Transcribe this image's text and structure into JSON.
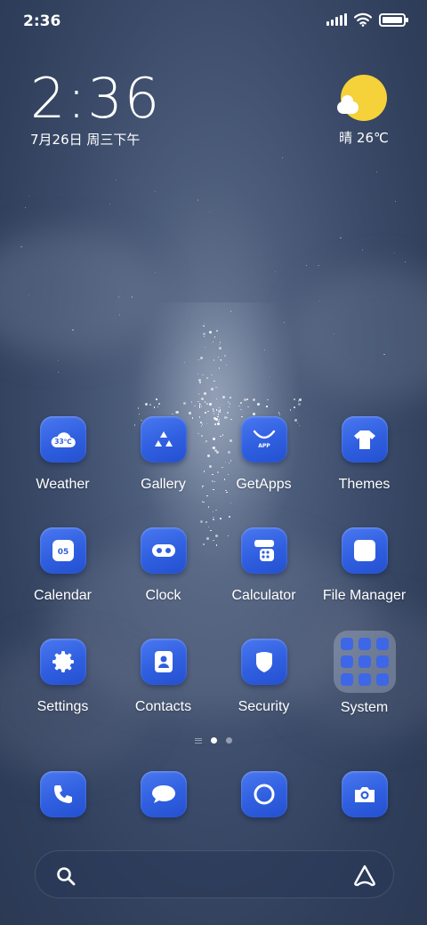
{
  "status_bar": {
    "time": "2:36",
    "icons": [
      "signal-icon",
      "wifi-icon",
      "battery-icon"
    ],
    "battery_level": 1.0
  },
  "clock_widget": {
    "time": "2:36",
    "date": "7月26日 周三下午"
  },
  "weather_widget": {
    "icon": "sun-cloud-icon",
    "text": "晴 26℃"
  },
  "apps": [
    {
      "label": "Weather",
      "icon": "weather-icon",
      "badge": "33℃"
    },
    {
      "label": "Gallery",
      "icon": "gallery-icon"
    },
    {
      "label": "GetApps",
      "icon": "getapps-icon",
      "badge": "APP"
    },
    {
      "label": "Themes",
      "icon": "themes-icon"
    },
    {
      "label": "Calendar",
      "icon": "calendar-icon",
      "badge": "05"
    },
    {
      "label": "Clock",
      "icon": "clock-icon"
    },
    {
      "label": "Calculator",
      "icon": "calculator-icon"
    },
    {
      "label": "File Manager",
      "icon": "file-manager-icon"
    },
    {
      "label": "Settings",
      "icon": "settings-icon"
    },
    {
      "label": "Contacts",
      "icon": "contacts-icon"
    },
    {
      "label": "Security",
      "icon": "security-icon"
    },
    {
      "label": "System",
      "icon": "folder-icon"
    }
  ],
  "pager": {
    "pages": 2,
    "active_page": 1
  },
  "dock": [
    {
      "icon": "phone-icon"
    },
    {
      "icon": "messages-icon"
    },
    {
      "icon": "browser-icon"
    },
    {
      "icon": "camera-icon"
    }
  ],
  "search_bar": {
    "left_icon": "search-icon",
    "right_icon": "assistant-icon"
  },
  "colors": {
    "icon_blue": "#3563e6",
    "sun": "#f5d13a",
    "wallpaper": "#3a4a68"
  }
}
